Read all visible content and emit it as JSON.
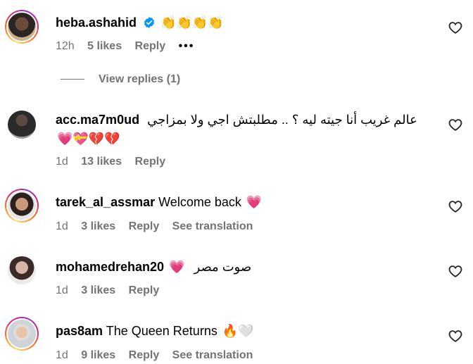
{
  "comments": [
    {
      "username": "heba.ashahid",
      "text": "",
      "emojis": "👏👏👏👏",
      "time": "12h",
      "likes": "5 likes",
      "reply": "Reply",
      "more": "•••",
      "verified": true,
      "view_replies": "View replies (1)"
    },
    {
      "username": "acc.ma7m0ud",
      "text": "عالم غريب أنا جيته ليه ؟ .. مطلبتش اجي ولا بمزاجي",
      "emojis": "💗💝💔💔",
      "time": "1d",
      "likes": "13 likes",
      "reply": "Reply"
    },
    {
      "username": "tarek_al_assmar",
      "text": "Welcome back",
      "emojis": "💗",
      "time": "1d",
      "likes": "3 likes",
      "reply": "Reply",
      "translation": "See translation"
    },
    {
      "username": "mohamedrehan20",
      "text": "صوت مصر",
      "emojis": "💗",
      "time": "1d",
      "likes": "3 likes",
      "reply": "Reply"
    },
    {
      "username": "pas8am",
      "text": "The Queen Returns",
      "emojis": "🔥🤍",
      "time": "1d",
      "likes": "9 likes",
      "reply": "Reply",
      "translation": "See translation"
    }
  ]
}
